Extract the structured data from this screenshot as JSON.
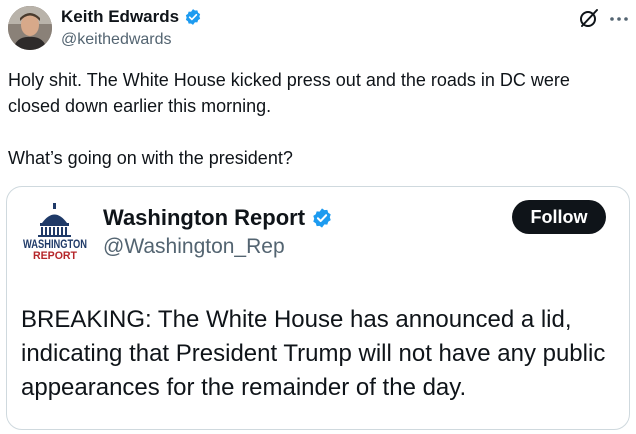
{
  "post": {
    "author_name": "Keith Edwards",
    "author_handle": "@keithedwards",
    "text_paragraphs": [
      "Holy shit. The White House kicked press out and the roads in DC were closed down earlier this morning.",
      "What’s going on with the president?"
    ]
  },
  "quote": {
    "logo_text_top": "WASHINGTON",
    "logo_text_bottom": "REPORT",
    "author_name": "Washington Report",
    "author_handle": "@Washington_Rep",
    "follow_label": "Follow",
    "text": "BREAKING: The White House has announced a lid, indicating that President Trump will not have any public appearances for the remainder of the day."
  },
  "icons": {
    "verified": "verified-badge-icon",
    "grok": "grok-icon",
    "more": "more-options-icon"
  },
  "colors": {
    "verified_blue": "#1d9bf0",
    "secondary_text": "#536471",
    "follow_button_bg": "#0f1419",
    "logo_navy": "#1f3a68",
    "logo_red": "#b5262a"
  }
}
